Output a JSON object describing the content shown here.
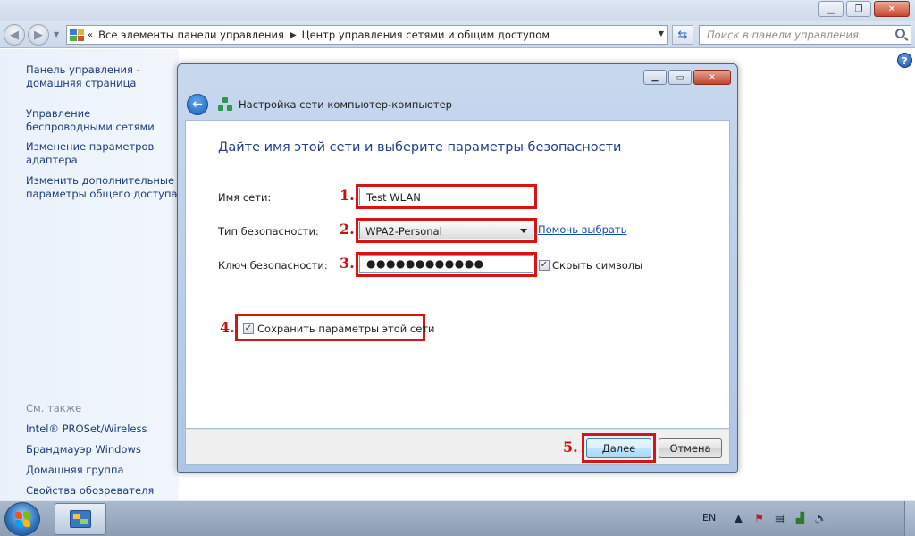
{
  "explorer": {
    "address_root": "Все элементы панели управления",
    "address_current": "Центр управления сетями и общим доступом",
    "search_placeholder": "Поиск в панели управления"
  },
  "left_pane": {
    "tasks": [
      "Панель управления - домашняя страница",
      "Управление беспроводными сетями",
      "Изменение параметров адаптера",
      "Изменить дополнительные параметры общего доступа"
    ],
    "see_also_title": "См. также",
    "see_also": [
      "Intel® PROSet/Wireless",
      "Брандмауэр Windows",
      "Домашняя группа",
      "Свойства обозревателя"
    ]
  },
  "dialog": {
    "title": "Настройка сети компьютер-компьютер",
    "heading": "Дайте имя этой сети и выберите параметры безопасности",
    "network_name_label": "Имя сети:",
    "network_name_value": "Test WLAN",
    "security_type_label": "Тип безопасности:",
    "security_type_value": "WPA2-Personal",
    "help_link": "Помочь выбрать",
    "security_key_label": "Ключ безопасности:",
    "security_key_masked": "●●●●●●●●●●●●",
    "hide_chars_label": "Скрыть символы",
    "hide_chars_checked": true,
    "save_params_label": "Сохранить параметры этой сети",
    "save_params_checked": true,
    "next_button": "Далее",
    "cancel_button": "Отмена"
  },
  "annotations": [
    "1.",
    "2.",
    "3.",
    "4.",
    "5."
  ],
  "annotation_color": "#d61414",
  "taskbar": {
    "language": "EN"
  }
}
